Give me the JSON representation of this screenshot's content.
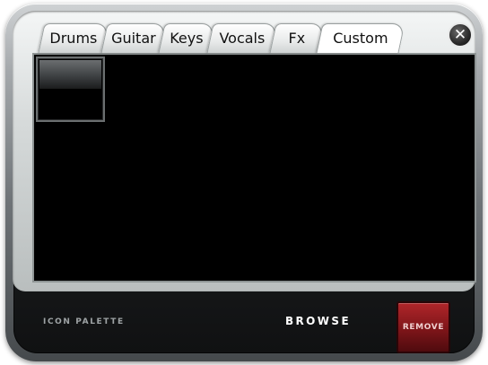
{
  "tabs": [
    {
      "label": "Drums"
    },
    {
      "label": "Guitar"
    },
    {
      "label": "Keys"
    },
    {
      "label": "Vocals"
    },
    {
      "label": "Fx"
    },
    {
      "label": "Custom"
    }
  ],
  "active_tab": "Custom",
  "close_icon": "close-icon",
  "footer": {
    "palette_label": "ICON PALETTE",
    "browse_label": "BROWSE",
    "remove_label": "REMOVE"
  },
  "colors": {
    "remove_button": "#8b1a1e",
    "panel_background": "#000000"
  }
}
